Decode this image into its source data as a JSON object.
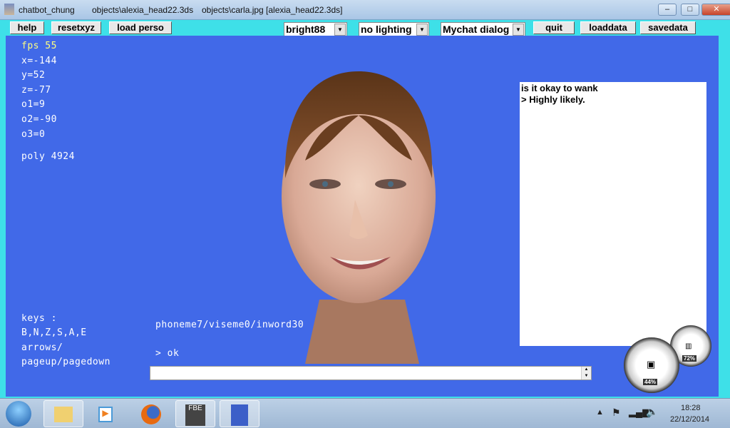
{
  "window": {
    "app": "chatbot_chung",
    "object": "objects\\alexia_head22.3ds",
    "texture": "objects\\carla.jpg  [alexia_head22.3ds]",
    "minimize": "–",
    "maximize": "□",
    "close": "✕"
  },
  "toolbar": {
    "help": "help",
    "resetxyz": "resetxyz",
    "load_perso": "load perso",
    "brightness": "bright88",
    "lighting": "no lighting",
    "dialog": "Mychat dialog",
    "quit": "quit",
    "loaddata": "loaddata",
    "savedata": "savedata"
  },
  "stats": {
    "fps": "fps 55",
    "x": "x=-144",
    "y": "y=52",
    "z": "z=-77",
    "o1": "o1=9",
    "o2": "o2=-90",
    "o3": "o3=0",
    "poly": "poly 4924"
  },
  "keys": {
    "title": "keys :",
    "line1": "B,N,Z,S,A,E",
    "line2": "arrows/",
    "line3": "pageup/pagedown"
  },
  "status": {
    "phoneme": "phoneme7/viseme0/inword30",
    "reply": "> ok"
  },
  "chat": {
    "question": "is it okay to wank",
    "answer": "> Highly likely."
  },
  "input": {
    "value": ""
  },
  "gadget": {
    "cpu": "44%",
    "memory": "72%"
  },
  "taskbar": {
    "time": "18:28",
    "date": "22/12/2014"
  }
}
